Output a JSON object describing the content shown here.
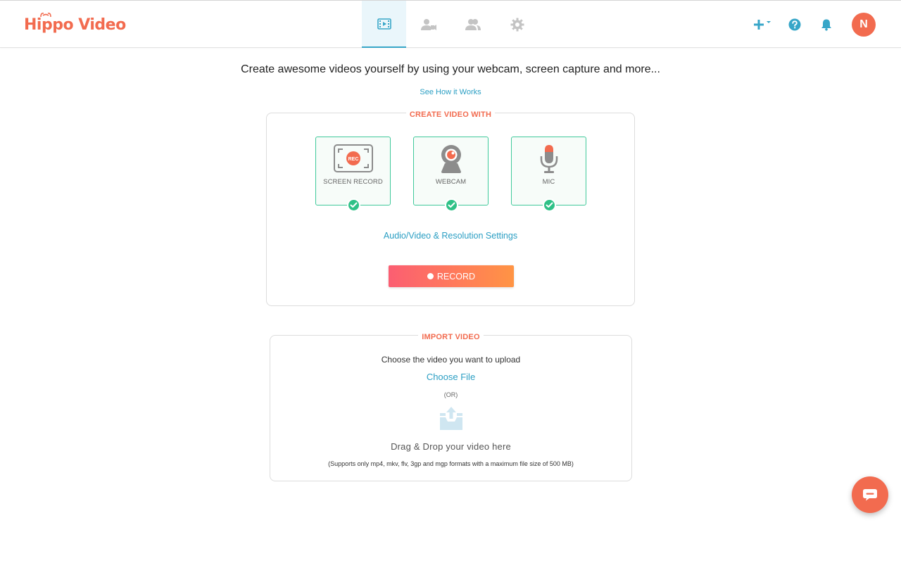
{
  "app": {
    "logo_text": "Hippo Video",
    "brand_color": "#f26b4f",
    "accent_color": "#2a9ec3"
  },
  "nav": {
    "tabs": [
      {
        "icon": "video-library-icon",
        "active": true
      },
      {
        "icon": "webcam-user-icon",
        "active": false
      },
      {
        "icon": "contacts-icon",
        "active": false
      },
      {
        "icon": "gear-icon",
        "active": false
      }
    ]
  },
  "header": {
    "actions": [
      "plus-dropdown-icon",
      "help-icon",
      "bell-icon"
    ],
    "avatar_initial": "N"
  },
  "main": {
    "tagline": "Create awesome videos yourself by using your webcam, screen capture and more...",
    "how_link": "See How it Works"
  },
  "create": {
    "legend": "CREATE VIDEO WITH",
    "options": [
      {
        "label": "SCREEN RECORD",
        "icon": "screen-record-icon",
        "checked": true
      },
      {
        "label": "WEBCAM",
        "icon": "webcam-icon",
        "checked": true
      },
      {
        "label": "MIC",
        "icon": "mic-icon",
        "checked": true
      }
    ],
    "rec_badge": "REC",
    "settings_link": "Audio/Video & Resolution Settings",
    "record_label": "RECORD"
  },
  "import": {
    "legend": "IMPORT VIDEO",
    "prompt": "Choose the video you want to upload",
    "choose_file": "Choose File",
    "or_text": "(OR)",
    "drag_text": "Drag & Drop your video here",
    "support_text": "(Supports only mp4, mkv, flv, 3gp and mgp formats with a maximum file size of 500 MB)"
  },
  "chat": {
    "icon": "chat-icon"
  }
}
